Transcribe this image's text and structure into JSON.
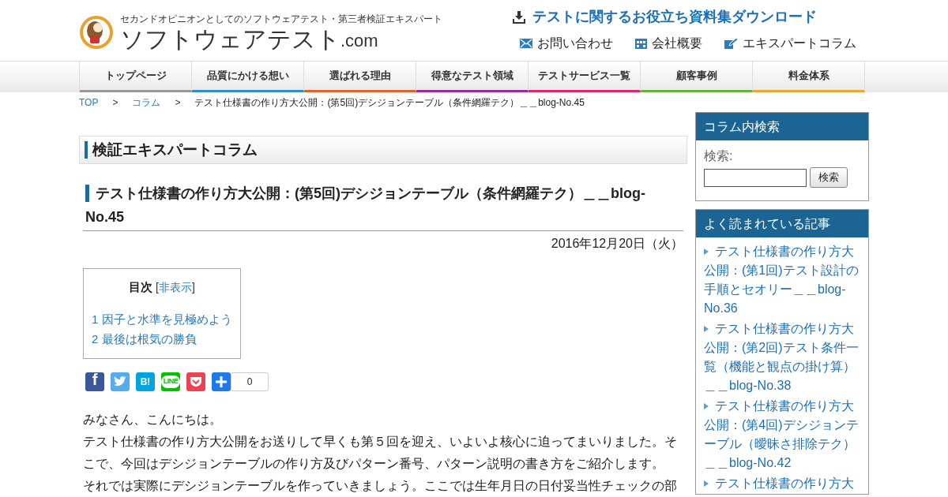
{
  "header": {
    "tagline": "セカンドオピニオンとしてのソフトウェアテスト・第三者検証エキスパート",
    "logo_main": "ソフトウェアテスト",
    "logo_suffix": ".com",
    "download": "テストに関するお役立ち資料集ダウンロード",
    "links": [
      {
        "kind": "mail",
        "label": "お問い合わせ"
      },
      {
        "kind": "company",
        "label": "会社概要"
      },
      {
        "kind": "pen",
        "label": "エキスパートコラム"
      }
    ]
  },
  "nav": [
    {
      "label": "トップページ",
      "color": "#9a9a9a"
    },
    {
      "label": "品質にかける想い",
      "color": "#2a8fc4"
    },
    {
      "label": "選ばれる理由",
      "color": "#e2622a"
    },
    {
      "label": "得意なテスト領域",
      "color": "#9b2a9e"
    },
    {
      "label": "テストサービス一覧",
      "color": "#d8296d"
    },
    {
      "label": "顧客事例",
      "color": "#62b53a"
    },
    {
      "label": "料金体系",
      "color": "#eea531"
    }
  ],
  "breadcrumb": [
    {
      "label": "TOP",
      "link": true
    },
    {
      "label": "コラム",
      "link": true
    },
    {
      "label": "テスト仕様書の作り方大公開：(第5回)デシジョンテーブル（条件網羅テク）＿＿blog-No.45",
      "link": false
    }
  ],
  "breadcrumb_separator": ">",
  "section_title": "検証エキスパートコラム",
  "article": {
    "title": "テスト仕様書の作り方大公開：(第5回)デシジョンテーブル（条件網羅テク）＿＿blog-No.45",
    "date": "2016年12月20日（火）",
    "toc": {
      "title": "目次",
      "toggle": "非表示",
      "toggle_brackets": [
        "[",
        "]"
      ],
      "items": [
        "1 因子と水準を見極めよう",
        "2 最後は根気の勝負"
      ]
    },
    "share": [
      {
        "kind": "facebook",
        "glyph": "f"
      },
      {
        "kind": "twitter"
      },
      {
        "kind": "hatena",
        "glyph": "B!"
      },
      {
        "kind": "line",
        "glyph": "LINE"
      },
      {
        "kind": "pocket"
      },
      {
        "kind": "add"
      }
    ],
    "share_count": "0",
    "paragraphs": [
      "みなさん、こんにちは。",
      "テスト仕様書の作り方大公開をお送りして早くも第５回を迎え、いよいよ核心に迫ってまいりました。そこで、今回はデシジョンテーブルの作り方及びパターン番号、パターン説明の書き方をご紹介します。",
      "それでは実際にデシジョンテーブルを作っていきましょう。ここでは生年月日の日付妥当性チェックの部"
    ]
  },
  "sidebar": {
    "search": {
      "title": "コラム内検索",
      "label": "検索:",
      "button": "検索"
    },
    "popular": {
      "title": "よく読まれている記事",
      "items": [
        "テスト仕様書の作り方大公開：(第1回)テスト設計の手順とセオリー＿＿blog-No.36",
        "テスト仕様書の作り方大公開：(第2回)テスト条件一覧（機能と観点の掛け算）＿＿blog-No.38",
        "テスト仕様書の作り方大公開：(第4回)デシジョンテーブル（曖昧さ排除テク）＿＿blog-No.42",
        "テスト仕様書の作り方大"
      ]
    }
  }
}
